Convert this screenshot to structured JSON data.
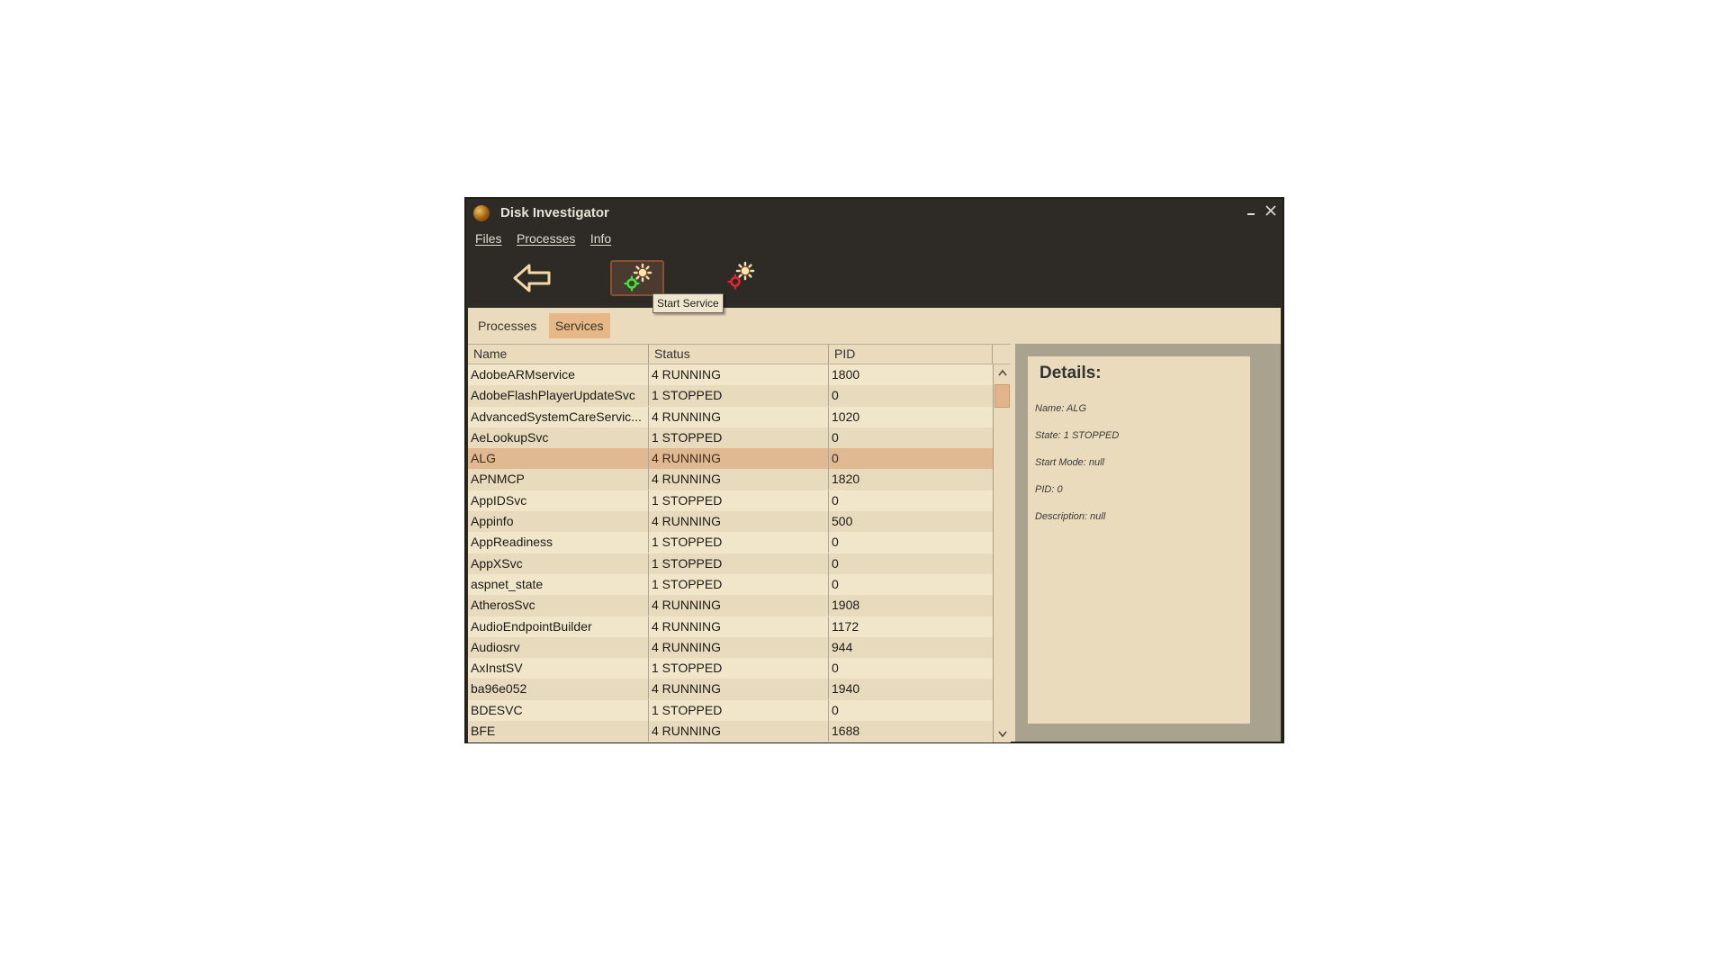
{
  "window": {
    "title": "Disk Investigator"
  },
  "menu": {
    "files": "Files",
    "processes": "Processes",
    "info": "Info"
  },
  "toolbar": {
    "tooltip": "Start Service"
  },
  "tabs": [
    {
      "label": "Processes",
      "active": false
    },
    {
      "label": "Services",
      "active": true
    }
  ],
  "table": {
    "columns": [
      "Name",
      "Status",
      "PID"
    ],
    "selected_index": 4,
    "rows": [
      {
        "name": "AdobeARMservice",
        "status": "4  RUNNING",
        "pid": "1800"
      },
      {
        "name": "AdobeFlashPlayerUpdateSvc",
        "status": "1  STOPPED",
        "pid": "0"
      },
      {
        "name": "AdvancedSystemCareServic...",
        "status": "4  RUNNING",
        "pid": "1020"
      },
      {
        "name": "AeLookupSvc",
        "status": "1  STOPPED",
        "pid": "0"
      },
      {
        "name": "ALG",
        "status": "4 RUNNING",
        "pid": "0"
      },
      {
        "name": "APNMCP",
        "status": "4  RUNNING",
        "pid": "1820"
      },
      {
        "name": "AppIDSvc",
        "status": "1  STOPPED",
        "pid": "0"
      },
      {
        "name": "Appinfo",
        "status": "4  RUNNING",
        "pid": "500"
      },
      {
        "name": "AppReadiness",
        "status": "1  STOPPED",
        "pid": "0"
      },
      {
        "name": "AppXSvc",
        "status": "1  STOPPED",
        "pid": "0"
      },
      {
        "name": "aspnet_state",
        "status": "1  STOPPED",
        "pid": "0"
      },
      {
        "name": "AtherosSvc",
        "status": "4  RUNNING",
        "pid": "1908"
      },
      {
        "name": "AudioEndpointBuilder",
        "status": "4  RUNNING",
        "pid": "1172"
      },
      {
        "name": "Audiosrv",
        "status": "4  RUNNING",
        "pid": "944"
      },
      {
        "name": "AxInstSV",
        "status": "1  STOPPED",
        "pid": "0"
      },
      {
        "name": "ba96e052",
        "status": "4  RUNNING",
        "pid": "1940"
      },
      {
        "name": "BDESVC",
        "status": "1  STOPPED",
        "pid": "0"
      },
      {
        "name": "BFE",
        "status": "4  RUNNING",
        "pid": "1688"
      }
    ]
  },
  "details": {
    "heading": "Details:",
    "name": "Name: ALG",
    "state": "State: 1  STOPPED",
    "start_mode": "Start Mode: null",
    "pid": "PID: 0",
    "description": "Description: null"
  }
}
